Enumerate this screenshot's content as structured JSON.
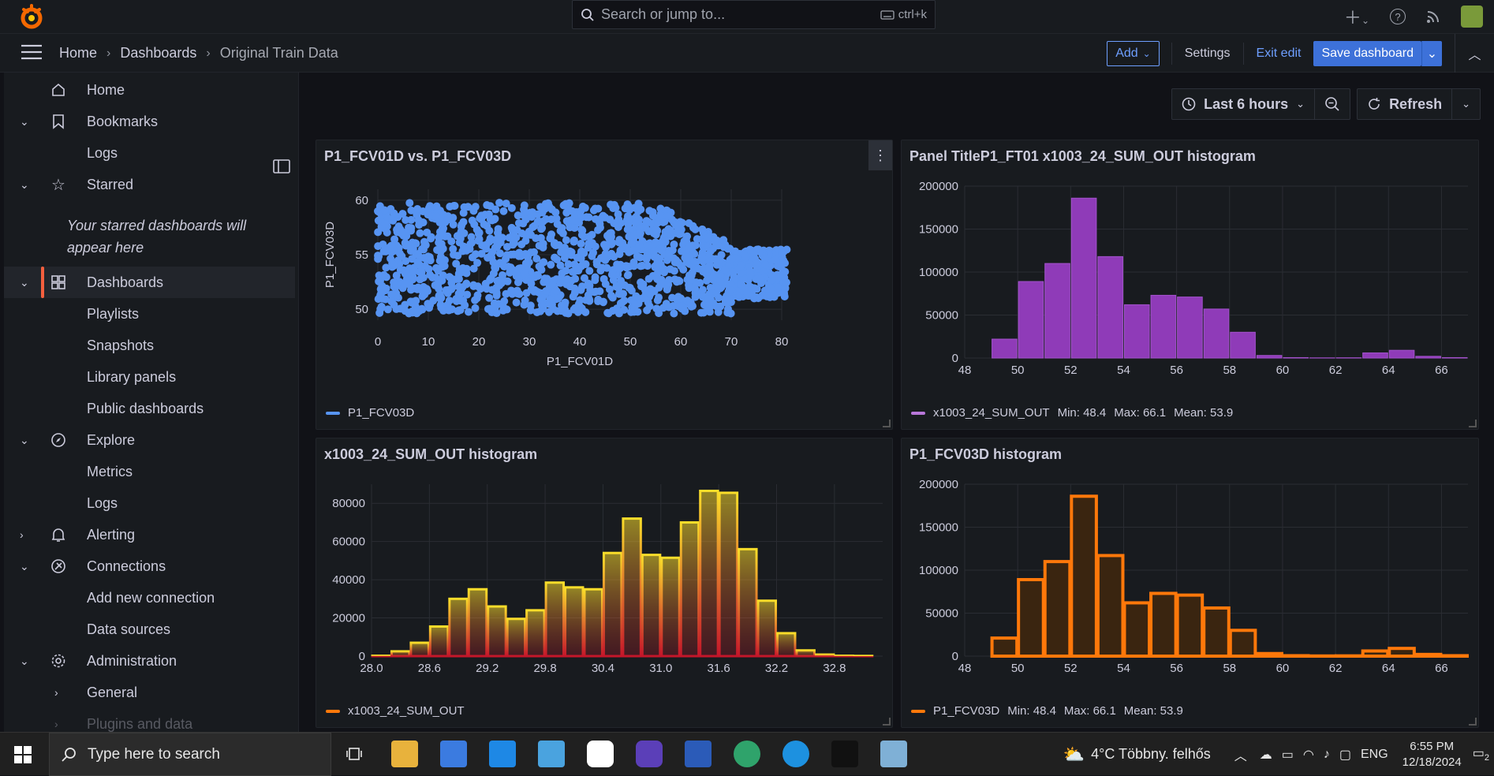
{
  "topbar": {
    "search_placeholder": "Search or jump to...",
    "search_shortcut": "ctrl+k",
    "add_icon": "plus-icon",
    "help_icon": "help-icon",
    "news_icon": "rss-icon"
  },
  "breadcrumb": {
    "home": "Home",
    "dashboards": "Dashboards",
    "current": "Original Train Data"
  },
  "navbar": {
    "add_label": "Add",
    "settings_label": "Settings",
    "exit_label": "Exit edit",
    "save_label": "Save dashboard"
  },
  "sidebar": {
    "items": [
      {
        "label": "Home",
        "icon": "home-icon"
      },
      {
        "label": "Bookmarks",
        "icon": "bookmark-icon"
      },
      {
        "label": "Logs"
      },
      {
        "label": "Starred",
        "icon": "star-icon"
      },
      {
        "label": "Dashboards",
        "icon": "dashboards-icon"
      },
      {
        "label": "Playlists"
      },
      {
        "label": "Snapshots"
      },
      {
        "label": "Library panels"
      },
      {
        "label": "Public dashboards"
      },
      {
        "label": "Explore",
        "icon": "compass-icon"
      },
      {
        "label": "Metrics"
      },
      {
        "label": "Logs"
      },
      {
        "label": "Alerting",
        "icon": "bell-icon"
      },
      {
        "label": "Connections",
        "icon": "connections-icon"
      },
      {
        "label": "Add new connection"
      },
      {
        "label": "Data sources"
      },
      {
        "label": "Administration",
        "icon": "gear-icon"
      },
      {
        "label": "General"
      },
      {
        "label": "Plugins and data"
      }
    ],
    "starred_note": "Your starred dashboards will appear here"
  },
  "timepicker": {
    "range": "Last 6 hours",
    "refresh": "Refresh"
  },
  "colors": {
    "blue": "#5794f2",
    "purple": "#8f3bb8",
    "red": "#c4162a",
    "orange": "#ff780a",
    "accent": "#3d71d9"
  },
  "panels": [
    {
      "title": "P1_FCV01D vs. P1_FCV03D",
      "legend": "P1_FCV03D",
      "chart_data": {
        "type": "scatter",
        "xlabel": "P1_FCV01D",
        "ylabel": "P1_FCV03D",
        "xlim": [
          0,
          80
        ],
        "ylim": [
          49,
          61
        ],
        "xticks": [
          "0",
          "10",
          "20",
          "30",
          "40",
          "50",
          "60",
          "70",
          "80"
        ],
        "yticks": [
          "50",
          "55",
          "60"
        ],
        "series": [
          {
            "name": "P1_FCV03D",
            "x_range": [
              0,
              81
            ],
            "y_range": [
              49.5,
              60
            ]
          }
        ]
      }
    },
    {
      "title": "Panel TitleP1_FT01 x1003_24_SUM_OUT histogram",
      "legend": "x1003_24_SUM_OUT",
      "stats": {
        "min": "Min: 48.4",
        "max": "Max: 66.1",
        "mean": "Mean: 53.9"
      },
      "chart_data": {
        "type": "bar",
        "xlim": [
          48,
          67
        ],
        "ylim": [
          0,
          200000
        ],
        "xticks": [
          "48",
          "50",
          "52",
          "54",
          "56",
          "58",
          "60",
          "62",
          "64",
          "66"
        ],
        "yticks": [
          "0",
          "50000",
          "100000",
          "150000",
          "200000"
        ],
        "bins": [
          [
            48,
            49,
            0
          ],
          [
            49,
            50,
            22000
          ],
          [
            50,
            51,
            89000
          ],
          [
            51,
            52,
            110000
          ],
          [
            52,
            53,
            186000
          ],
          [
            53,
            54,
            118000
          ],
          [
            54,
            55,
            62000
          ],
          [
            55,
            56,
            73000
          ],
          [
            56,
            57,
            71000
          ],
          [
            57,
            58,
            57000
          ],
          [
            58,
            59,
            30000
          ],
          [
            59,
            60,
            3000
          ],
          [
            60,
            61,
            500
          ],
          [
            61,
            62,
            200
          ],
          [
            62,
            63,
            300
          ],
          [
            63,
            64,
            6000
          ],
          [
            64,
            65,
            9000
          ],
          [
            65,
            66,
            2000
          ],
          [
            66,
            67,
            500
          ]
        ]
      }
    },
    {
      "title": "x1003_24_SUM_OUT histogram",
      "legend": "x1003_24_SUM_OUT",
      "chart_data": {
        "type": "bar",
        "xlim": [
          28.0,
          33.3
        ],
        "ylim": [
          0,
          90000
        ],
        "xticks": [
          "28.0",
          "28.6",
          "29.2",
          "29.8",
          "30.4",
          "31.0",
          "31.6",
          "32.2",
          "32.8"
        ],
        "yticks": [
          "0",
          "20000",
          "40000",
          "60000",
          "80000"
        ],
        "bins": [
          [
            28.0,
            28.2,
            200
          ],
          [
            28.2,
            28.4,
            2500
          ],
          [
            28.4,
            28.6,
            7000
          ],
          [
            28.6,
            28.8,
            15500
          ],
          [
            28.8,
            29.0,
            30000
          ],
          [
            29.0,
            29.2,
            35000
          ],
          [
            29.2,
            29.4,
            26000
          ],
          [
            29.4,
            29.6,
            19500
          ],
          [
            29.6,
            29.8,
            24000
          ],
          [
            29.8,
            30.0,
            38500
          ],
          [
            30.0,
            30.2,
            36000
          ],
          [
            30.2,
            30.4,
            35000
          ],
          [
            30.4,
            30.6,
            54000
          ],
          [
            30.6,
            30.8,
            72000
          ],
          [
            30.8,
            31.0,
            53000
          ],
          [
            31.0,
            31.2,
            51500
          ],
          [
            31.2,
            31.4,
            70000
          ],
          [
            31.4,
            31.6,
            86500
          ],
          [
            31.6,
            31.8,
            85500
          ],
          [
            31.8,
            32.0,
            56000
          ],
          [
            32.0,
            32.2,
            29000
          ],
          [
            32.2,
            32.4,
            12000
          ],
          [
            32.4,
            32.6,
            3000
          ],
          [
            32.6,
            32.8,
            800
          ],
          [
            32.8,
            33.0,
            200
          ],
          [
            33.0,
            33.2,
            100
          ]
        ]
      }
    },
    {
      "title": "P1_FCV03D histogram",
      "legend": "P1_FCV03D",
      "stats": {
        "min": "Min: 48.4",
        "max": "Max: 66.1",
        "mean": "Mean: 53.9"
      },
      "chart_data": {
        "type": "bar",
        "xlim": [
          48,
          67
        ],
        "ylim": [
          0,
          200000
        ],
        "xticks": [
          "48",
          "50",
          "52",
          "54",
          "56",
          "58",
          "60",
          "62",
          "64",
          "66"
        ],
        "yticks": [
          "0",
          "50000",
          "100000",
          "150000",
          "200000"
        ],
        "bins": [
          [
            48,
            49,
            0
          ],
          [
            49,
            50,
            21000
          ],
          [
            50,
            51,
            89000
          ],
          [
            51,
            52,
            110000
          ],
          [
            52,
            53,
            186000
          ],
          [
            53,
            54,
            117000
          ],
          [
            54,
            55,
            62000
          ],
          [
            55,
            56,
            73000
          ],
          [
            56,
            57,
            71000
          ],
          [
            57,
            58,
            56000
          ],
          [
            58,
            59,
            30000
          ],
          [
            59,
            60,
            3000
          ],
          [
            60,
            61,
            500
          ],
          [
            61,
            62,
            200
          ],
          [
            62,
            63,
            300
          ],
          [
            63,
            64,
            6000
          ],
          [
            64,
            65,
            9000
          ],
          [
            65,
            66,
            2000
          ],
          [
            66,
            67,
            500
          ]
        ]
      }
    }
  ],
  "taskbar": {
    "search_placeholder": "Type here to search",
    "weather": "4°C  Többny. felhős",
    "lang": "ENG",
    "time": "6:55 PM",
    "date": "12/18/2024",
    "notif_count": "2"
  }
}
